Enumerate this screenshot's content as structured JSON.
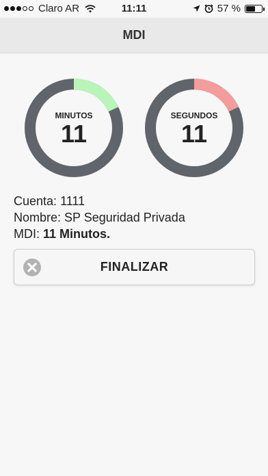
{
  "status_bar": {
    "carrier": "Claro AR",
    "time": "11:11",
    "battery": "57 %",
    "battery_level": 0.57
  },
  "nav": {
    "title": "MDI"
  },
  "gauges": {
    "minutos": {
      "label": "MINUTOS",
      "value": "11",
      "fraction": 0.18,
      "accent": "#b9f5b9"
    },
    "segundos": {
      "label": "SEGUNDOS",
      "value": "11",
      "fraction": 0.18,
      "accent": "#f49b9b"
    },
    "track_color": "#60646b"
  },
  "info": {
    "cuenta_label": "Cuenta:",
    "cuenta_value": "1111",
    "nombre_label": "Nombre:",
    "nombre_value": "SP Seguridad Privada",
    "mdi_label": "MDI:",
    "mdi_value": "11 Minutos."
  },
  "button": {
    "label": "FINALIZAR",
    "icon": "close-circle-icon"
  }
}
